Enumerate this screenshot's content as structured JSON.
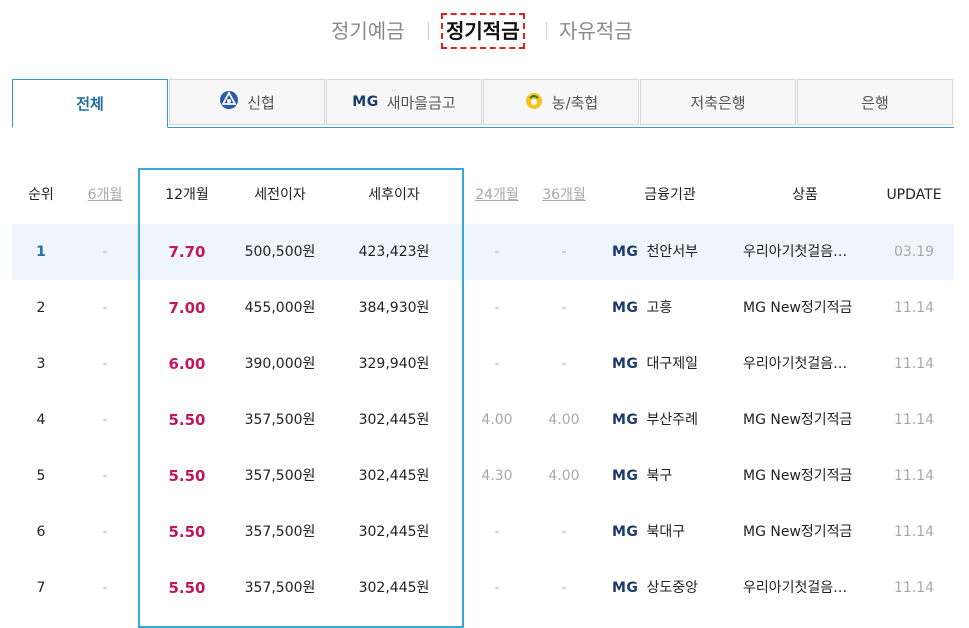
{
  "top_tabs": [
    "정기예금",
    "정기적금",
    "자유적금"
  ],
  "org_tabs": [
    {
      "label": "전체",
      "icon": null
    },
    {
      "label": "신협",
      "icon": "shinhyup-logo-icon"
    },
    {
      "label": "새마을금고",
      "icon": "mg-logo-icon"
    },
    {
      "label": "농/축협",
      "icon": "nonghyup-logo-icon"
    },
    {
      "label": "저축은행",
      "icon": null
    },
    {
      "label": "은행",
      "icon": null
    }
  ],
  "mg_mark": "MG",
  "headers": {
    "rank": "순위",
    "m6": "6개월",
    "m12": "12개월",
    "pretax": "세전이자",
    "posttax": "세후이자",
    "m24": "24개월",
    "m36": "36개월",
    "institution": "금융기관",
    "product": "상품",
    "update": "UPDATE"
  },
  "rows": [
    {
      "rank": "1",
      "m6": "-",
      "m12": "7.70",
      "pretax": "500,500원",
      "posttax": "423,423원",
      "m24": "-",
      "m36": "-",
      "institution": "천안서부",
      "product": "우리아기첫걸음…",
      "update": "03.19"
    },
    {
      "rank": "2",
      "m6": "-",
      "m12": "7.00",
      "pretax": "455,000원",
      "posttax": "384,930원",
      "m24": "-",
      "m36": "-",
      "institution": "고흥",
      "product": "MG New정기적금",
      "update": "11.14"
    },
    {
      "rank": "3",
      "m6": "-",
      "m12": "6.00",
      "pretax": "390,000원",
      "posttax": "329,940원",
      "m24": "-",
      "m36": "-",
      "institution": "대구제일",
      "product": "우리아기첫걸음…",
      "update": "11.14"
    },
    {
      "rank": "4",
      "m6": "-",
      "m12": "5.50",
      "pretax": "357,500원",
      "posttax": "302,445원",
      "m24": "4.00",
      "m36": "4.00",
      "institution": "부산주례",
      "product": "MG New정기적금",
      "update": "11.14"
    },
    {
      "rank": "5",
      "m6": "-",
      "m12": "5.50",
      "pretax": "357,500원",
      "posttax": "302,445원",
      "m24": "4.30",
      "m36": "4.00",
      "institution": "북구",
      "product": "MG New정기적금",
      "update": "11.14"
    },
    {
      "rank": "6",
      "m6": "-",
      "m12": "5.50",
      "pretax": "357,500원",
      "posttax": "302,445원",
      "m24": "-",
      "m36": "-",
      "institution": "북대구",
      "product": "MG New정기적금",
      "update": "11.14"
    },
    {
      "rank": "7",
      "m6": "-",
      "m12": "5.50",
      "pretax": "357,500원",
      "posttax": "302,445원",
      "m24": "-",
      "m36": "-",
      "institution": "상도중앙",
      "product": "우리아기첫걸음…",
      "update": "11.14"
    }
  ],
  "colors": {
    "accent": "#2f9bd6",
    "rate": "#c2185b",
    "highlight_row": "#eef5fc",
    "mg": "#1c3a6b"
  }
}
